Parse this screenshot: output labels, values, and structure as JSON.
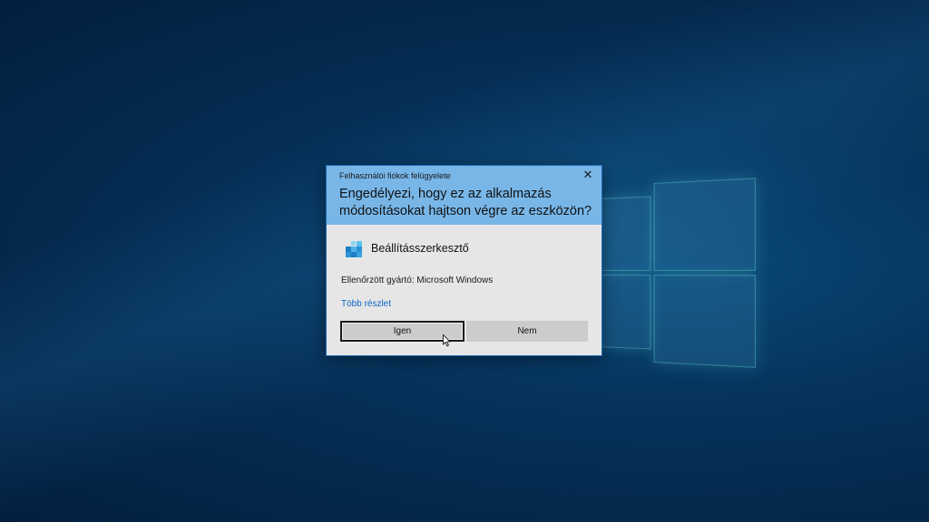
{
  "dialog": {
    "title": "Felhasználói fiókok felügyelete",
    "close_glyph": "✕",
    "question": "Engedélyezi, hogy ez az alkalmazás módosításokat hajtson végre az eszközön?",
    "app_icon": "registry-editor-icon",
    "app_name": "Beállításszerkesztő",
    "publisher": "Ellenőrzött gyártó: Microsoft Windows",
    "details_link": "Több részlet",
    "yes_label": "Igen",
    "no_label": "Nem"
  },
  "colors": {
    "header_bg": "#78b6e8",
    "body_bg": "#e6e6e6",
    "link": "#0a64c8",
    "button_bg": "#cccccc"
  }
}
